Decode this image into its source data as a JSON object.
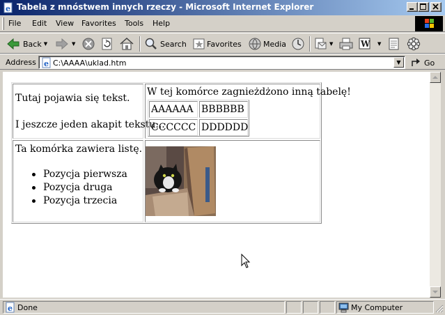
{
  "window": {
    "title": "Tabela z mnóstwem innych rzeczy - Microsoft Internet Explorer",
    "buttons": {
      "minimize": "0",
      "maximize": "1",
      "close": "r"
    }
  },
  "menu": {
    "file": "File",
    "edit": "Edit",
    "view": "View",
    "favorites": "Favorites",
    "tools": "Tools",
    "help": "Help"
  },
  "toolbar": {
    "back": "Back",
    "search": "Search",
    "favorites": "Favorites",
    "media": "Media"
  },
  "address": {
    "label": "Address",
    "value": "C:\\AAAA\\uklad.htm",
    "go": "Go"
  },
  "page": {
    "cell_top_left": {
      "paragraph1": "Tutaj pojawia się tekst.",
      "paragraph2": "I jeszcze jeden akapit tekstu..."
    },
    "cell_top_right": {
      "caption": "W tej komórce zagnieżdżono inną tabelę!",
      "nested_table": [
        [
          "AAAAAA",
          "BBBBBB"
        ],
        [
          "CCCCCC",
          "DDDDDD"
        ]
      ]
    },
    "cell_bottom_left": {
      "intro": "Ta komórka zawiera listę.",
      "items": [
        "Pozycja pierwsza",
        "Pozycja druga",
        "Pozycja trzecia"
      ]
    },
    "cell_bottom_right": {
      "image": "cat-in-cardboard-box-photo"
    }
  },
  "status": {
    "text": "Done",
    "zone": "My Computer"
  },
  "colors": {
    "titlebar_start": "#0a246a",
    "titlebar_end": "#a6caf0",
    "chrome": "#d4d0c8",
    "content_bg": "#ffffff"
  },
  "icons": [
    "ie-page-icon",
    "back-arrow-icon",
    "forward-arrow-icon",
    "stop-icon",
    "refresh-icon",
    "home-icon",
    "search-icon",
    "favorites-icon",
    "media-icon",
    "history-icon",
    "mail-icon",
    "print-icon",
    "edit-icon",
    "discuss-icon",
    "messenger-icon",
    "go-arrow-icon",
    "my-computer-icon",
    "windows-logo-icon"
  ]
}
